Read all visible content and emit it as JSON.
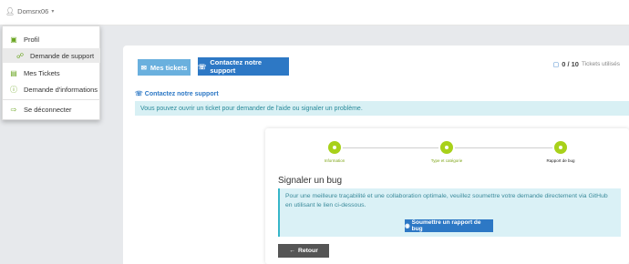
{
  "navbar": {
    "username": "Domsrx06",
    "user_icon": "user-icon",
    "caret_icon": "caret-down-icon"
  },
  "menu": {
    "items": [
      {
        "label": "Profil",
        "icon": "briefcase-icon"
      },
      {
        "label": "Demande de support",
        "icon": "support-icon"
      },
      {
        "label": "Mes Tickets",
        "icon": "ticket-icon"
      },
      {
        "label": "Demande d'informations",
        "icon": "info-icon"
      },
      {
        "label": "Se déconnecter",
        "icon": "logout-icon"
      }
    ]
  },
  "tabs": {
    "mine": "Mes tickets",
    "contact": "Contactez notre support"
  },
  "tickets": {
    "used": "0 / 10",
    "label": "Tickets utilisés"
  },
  "section": {
    "title": "Contactez notre support",
    "info": "Vous pouvez ouvrir un ticket pour demander de l'aide ou signaler un problème."
  },
  "wizard": {
    "steps": [
      "Information",
      "Type et catégorie",
      "Rapport de bug"
    ],
    "title": "Signaler un bug",
    "message": "Pour une meilleure traçabilité et une collaboration optimale, veuillez soumettre votre demande directement via GitHub en utilisant le lien ci-dessous.",
    "submit": "Soumettre un rapport de bug",
    "back": "Retour"
  },
  "colors": {
    "accent": "#2d78c5",
    "step_green": "#a8d11a",
    "info_bg": "#d8f0f4"
  }
}
